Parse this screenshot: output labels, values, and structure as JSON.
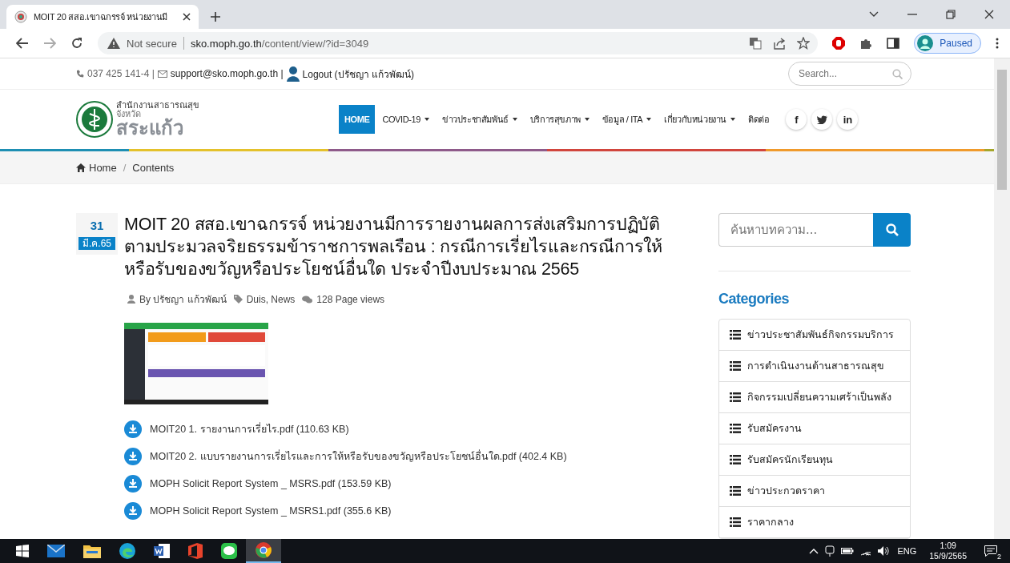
{
  "browser": {
    "tab_title": "MOIT 20 สสอ.เขาฉกรรจ์ หน่วยงานมี",
    "url_warning": "Not secure",
    "url_host": "sko.moph.go.th",
    "url_path": "/content/view/?id=3049",
    "profile": "Paused"
  },
  "topbar": {
    "phone": "037 425 141-4 |",
    "email": "support@sko.moph.go.th |",
    "logout": "Logout (ปรัชญา แก้วพัฒน์)",
    "search_placeholder": "Search..."
  },
  "logo": {
    "line1": "สำนักงานสาธารณสุข",
    "line2": "จังหวัด",
    "line3": "สระแก้ว"
  },
  "nav": [
    {
      "label": "HOME",
      "selected": true,
      "dropdown": false
    },
    {
      "label": "COVID-19",
      "selected": false,
      "dropdown": true
    },
    {
      "label": "ข่าวประชาสัมพันธ์",
      "selected": false,
      "dropdown": true
    },
    {
      "label": "บริการสุขภาพ",
      "selected": false,
      "dropdown": true
    },
    {
      "label": "ข้อมูล / ITA",
      "selected": false,
      "dropdown": true
    },
    {
      "label": "เกี่ยวกับหน่วยงาน",
      "selected": false,
      "dropdown": true
    },
    {
      "label": "ติดต่อ",
      "selected": false,
      "dropdown": false
    }
  ],
  "social": [
    {
      "label": "f"
    },
    {
      "kind": "twitter"
    },
    {
      "label": "in"
    }
  ],
  "breadcrumb": {
    "items": [
      "Home",
      "Contents"
    ],
    "separator": "/"
  },
  "article": {
    "day": "31",
    "month": "มี.ค.65",
    "title": "MOIT 20 สสอ.เขาฉกรรจ์ หน่วยงานมีการรายงานผลการส่งเสริมการปฏิบัติตามประมวลจริยธรรมข้าราชการพลเรือน : กรณีการเรี่ยไรและกรณีการให้หรือรับของขวัญหรือประโยชน์อื่นใด ประจำปีงบประมาณ 2565",
    "author": "By ปรัชญา แก้วพัฒน์",
    "tags": "Duis, News",
    "views": "128 Page views",
    "files": [
      "MOIT20 1. รายงานการเรี่ยไร.pdf (110.63 KB)",
      "MOIT20 2. แบบรายงานการเรี่ยไรและการให้หรือรับของขวัญหรือประโยชน์อื่นใด.pdf (402.4 KB)",
      "MOPH Solicit Report System _ MSRS.pdf (153.59 KB)",
      "MOPH Solicit Report System _ MSRS1.pdf (355.6 KB)"
    ]
  },
  "sidebar": {
    "search_placeholder": "ค้นหาบทความ...",
    "categories_title": "Categories",
    "categories": [
      "ข่าวประชาสัมพันธ์กิจกรรมบริการ",
      "การดำเนินงานด้านสาธารณสุข",
      "กิจกรรมเปลี่ยนความเศร้าเป็นพลัง",
      "รับสมัครงาน",
      "รับสมัครนักเรียนทุน",
      "ข่าวประกวดราคา",
      "ราคากลาง"
    ]
  },
  "taskbar": {
    "language": "ENG",
    "time": "1:09",
    "date": "15/9/2565",
    "notifications": "2"
  }
}
